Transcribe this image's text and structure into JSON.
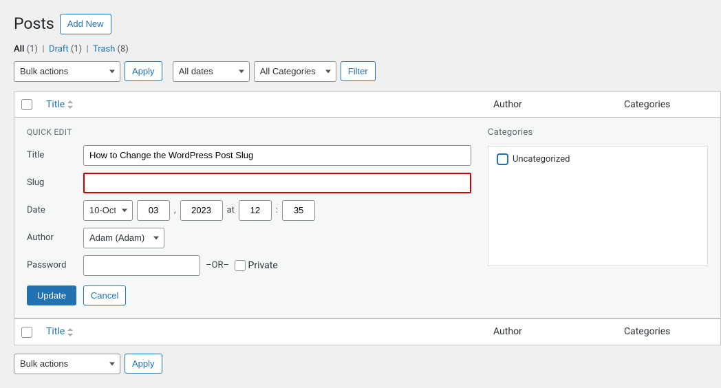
{
  "page": {
    "title": "Posts",
    "add_new": "Add New"
  },
  "status_links": {
    "all_label": "All",
    "all_count": "(1)",
    "draft_label": "Draft",
    "draft_count": "(1)",
    "trash_label": "Trash",
    "trash_count": "(8)"
  },
  "filters": {
    "bulk_actions": "Bulk actions",
    "apply": "Apply",
    "all_dates": "All dates",
    "all_categories": "All Categories",
    "filter": "Filter"
  },
  "columns": {
    "title": "Title",
    "author": "Author",
    "categories": "Categories"
  },
  "quick_edit": {
    "heading": "QUICK EDIT",
    "title_label": "Title",
    "title_value": "How to Change the WordPress Post Slug",
    "slug_label": "Slug",
    "slug_value": "",
    "date_label": "Date",
    "month": "10-Oct",
    "day": "03",
    "year": "2023",
    "at": "at",
    "hour": "12",
    "minute": "35",
    "author_label": "Author",
    "author_value": "Adam (Adam)",
    "password_label": "Password",
    "password_value": "",
    "or": "–OR–",
    "private_label": "Private",
    "categories_heading": "Categories",
    "cat_uncategorized": "Uncategorized",
    "update": "Update",
    "cancel": "Cancel"
  }
}
